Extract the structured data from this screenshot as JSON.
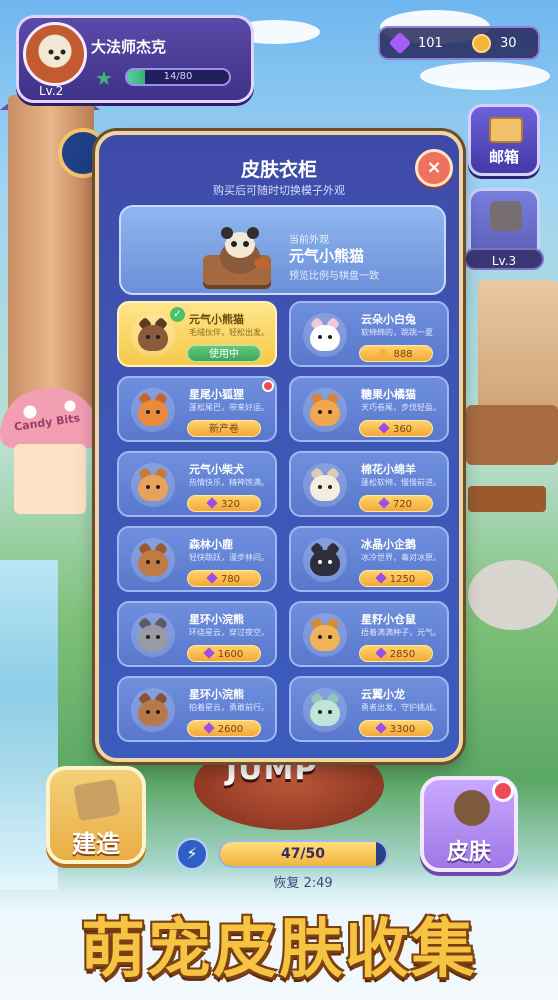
{
  "player": {
    "name": "大法师杰克",
    "level": "Lv.2",
    "xp_text": "14/80",
    "xp_fraction": 0.175
  },
  "currency": {
    "gems": "101",
    "coins": "30"
  },
  "side_buttons": {
    "mail_label": "邮箱",
    "locked_level": "Lv.3"
  },
  "modal": {
    "title": "皮肤衣柜",
    "subtitle": "购买后可随时切换模子外观",
    "close_icon": "×",
    "current": {
      "label": "当前外观",
      "name": "元气小熊猫",
      "desc": "预览比例与棋盘一致"
    }
  },
  "skins": [
    {
      "name": "元气小熊猫",
      "desc": "毛绒伙伴，轻松出发。",
      "status": "使用中",
      "kind": "using",
      "selected": true,
      "color": "#8a5a3a",
      "ear": "#5a3a24"
    },
    {
      "name": "云朵小白兔",
      "desc": "软绵绵的，跳跳一夏",
      "status": "888",
      "kind": "coin",
      "selected": false,
      "color": "#ffffff",
      "ear": "#f3c8d6"
    },
    {
      "name": "星尾小狐狸",
      "desc": "蓬松尾巴，带来好运。",
      "status": "新产卷",
      "kind": "plain",
      "selected": false,
      "color": "#e98a3d",
      "ear": "#c8652a",
      "badge": true
    },
    {
      "name": "糖果小橘猫",
      "desc": "天巧卷尾，步伐轻盈。",
      "status": "360",
      "kind": "gem",
      "selected": false,
      "color": "#f2a650",
      "ear": "#d8843a"
    },
    {
      "name": "元气小柴犬",
      "desc": "热情快乐，精神饱满。",
      "status": "320",
      "kind": "gem",
      "selected": false,
      "color": "#e8a35a",
      "ear": "#c9793a"
    },
    {
      "name": "棉花小绵羊",
      "desc": "蓬松软绵，慢慢前进。",
      "status": "720",
      "kind": "gem",
      "selected": false,
      "color": "#f4ede0",
      "ear": "#d9cdb8"
    },
    {
      "name": "森林小鹿",
      "desc": "轻快跳跃，漫步林间。",
      "status": "780",
      "kind": "gem",
      "selected": false,
      "color": "#c27a45",
      "ear": "#9a5a30"
    },
    {
      "name": "冰晶小企鹅",
      "desc": "冰冷世界，毒对冰原。",
      "status": "1250",
      "kind": "gem",
      "selected": false,
      "color": "#2e2e3a",
      "ear": "#2e2e3a"
    },
    {
      "name": "星环小浣熊",
      "desc": "环绕星云，穿过夜空。",
      "status": "1600",
      "kind": "gem",
      "selected": false,
      "color": "#9a9aa4",
      "ear": "#5b5b66"
    },
    {
      "name": "星籽小仓鼠",
      "desc": "捂着满满种子，元气。",
      "status": "2850",
      "kind": "gem",
      "selected": false,
      "color": "#f0b35a",
      "ear": "#d68c36"
    },
    {
      "name": "星环小浣熊",
      "desc": "拍着星云，勇敢前行。",
      "status": "2600",
      "kind": "gem",
      "selected": false,
      "color": "#b7784a",
      "ear": "#8a5430"
    },
    {
      "name": "云翼小龙",
      "desc": "勇者出发，守护挑战。",
      "status": "3300",
      "kind": "gem",
      "selected": false,
      "color": "#bfe5d6",
      "ear": "#8cc8b4"
    }
  ],
  "bottom": {
    "build_label": "建造",
    "energy_text": "47/50",
    "energy_fraction": 0.94,
    "recover_text": "恢复 2:49",
    "skin_label": "皮肤",
    "energy_icon": "⚡"
  },
  "scene": {
    "jump_text": "JUMP",
    "shop_sign": "Candy Bits"
  },
  "banner": "萌宠皮肤收集"
}
